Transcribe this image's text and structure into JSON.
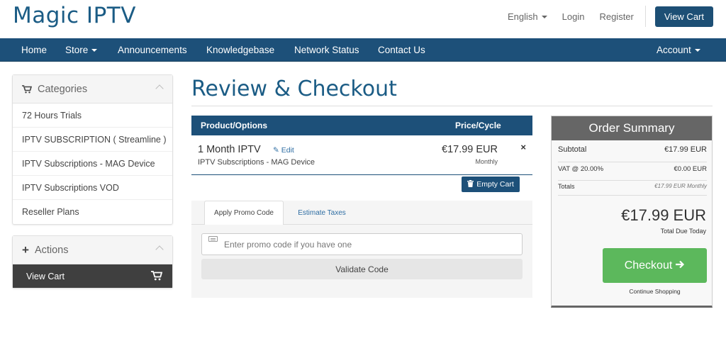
{
  "brand": {
    "logo": "Magic IPTV"
  },
  "top_links": {
    "language": "English",
    "login": "Login",
    "register": "Register",
    "view_cart": "View Cart"
  },
  "nav": {
    "items": [
      "Home",
      "Store",
      "Announcements",
      "Knowledgebase",
      "Network Status",
      "Contact Us"
    ],
    "account": "Account"
  },
  "sidebar": {
    "categories_title": "Categories",
    "categories": [
      "72 Hours Trials",
      "IPTV SUBSCRIPTION ( Streamline )",
      "IPTV Subscriptions - MAG Device",
      "IPTV Subscriptions VOD",
      "Reseller Plans"
    ],
    "actions_title": "Actions",
    "actions": [
      "View Cart"
    ]
  },
  "main": {
    "title": "Review & Checkout",
    "cart": {
      "col_product": "Product/Options",
      "col_price": "Price/Cycle",
      "item": {
        "name": "1 Month IPTV",
        "edit": "Edit",
        "group": "IPTV Subscriptions - MAG Device",
        "price": "€17.99 EUR",
        "cycle": "Monthly",
        "remove": "×"
      },
      "empty_cart": "Empty Cart"
    },
    "promo": {
      "tab_promo": "Apply Promo Code",
      "tab_taxes": "Estimate Taxes",
      "placeholder": "Enter promo code if you have one",
      "validate": "Validate Code"
    }
  },
  "summary": {
    "title": "Order Summary",
    "subtotal_label": "Subtotal",
    "subtotal_value": "€17.99 EUR",
    "vat_label": "VAT @ 20.00%",
    "vat_value": "€0.00 EUR",
    "totals_label": "Totals",
    "totals_value": "€17.99 EUR Monthly",
    "total_due": "€17.99 EUR",
    "total_due_label": "Total Due Today",
    "checkout": "Checkout",
    "continue": "Continue Shopping"
  },
  "colors": {
    "primary": "#1d5079",
    "brand_text": "#1b5c85",
    "checkout_green": "#5cb85c",
    "summary_head": "#666666"
  }
}
